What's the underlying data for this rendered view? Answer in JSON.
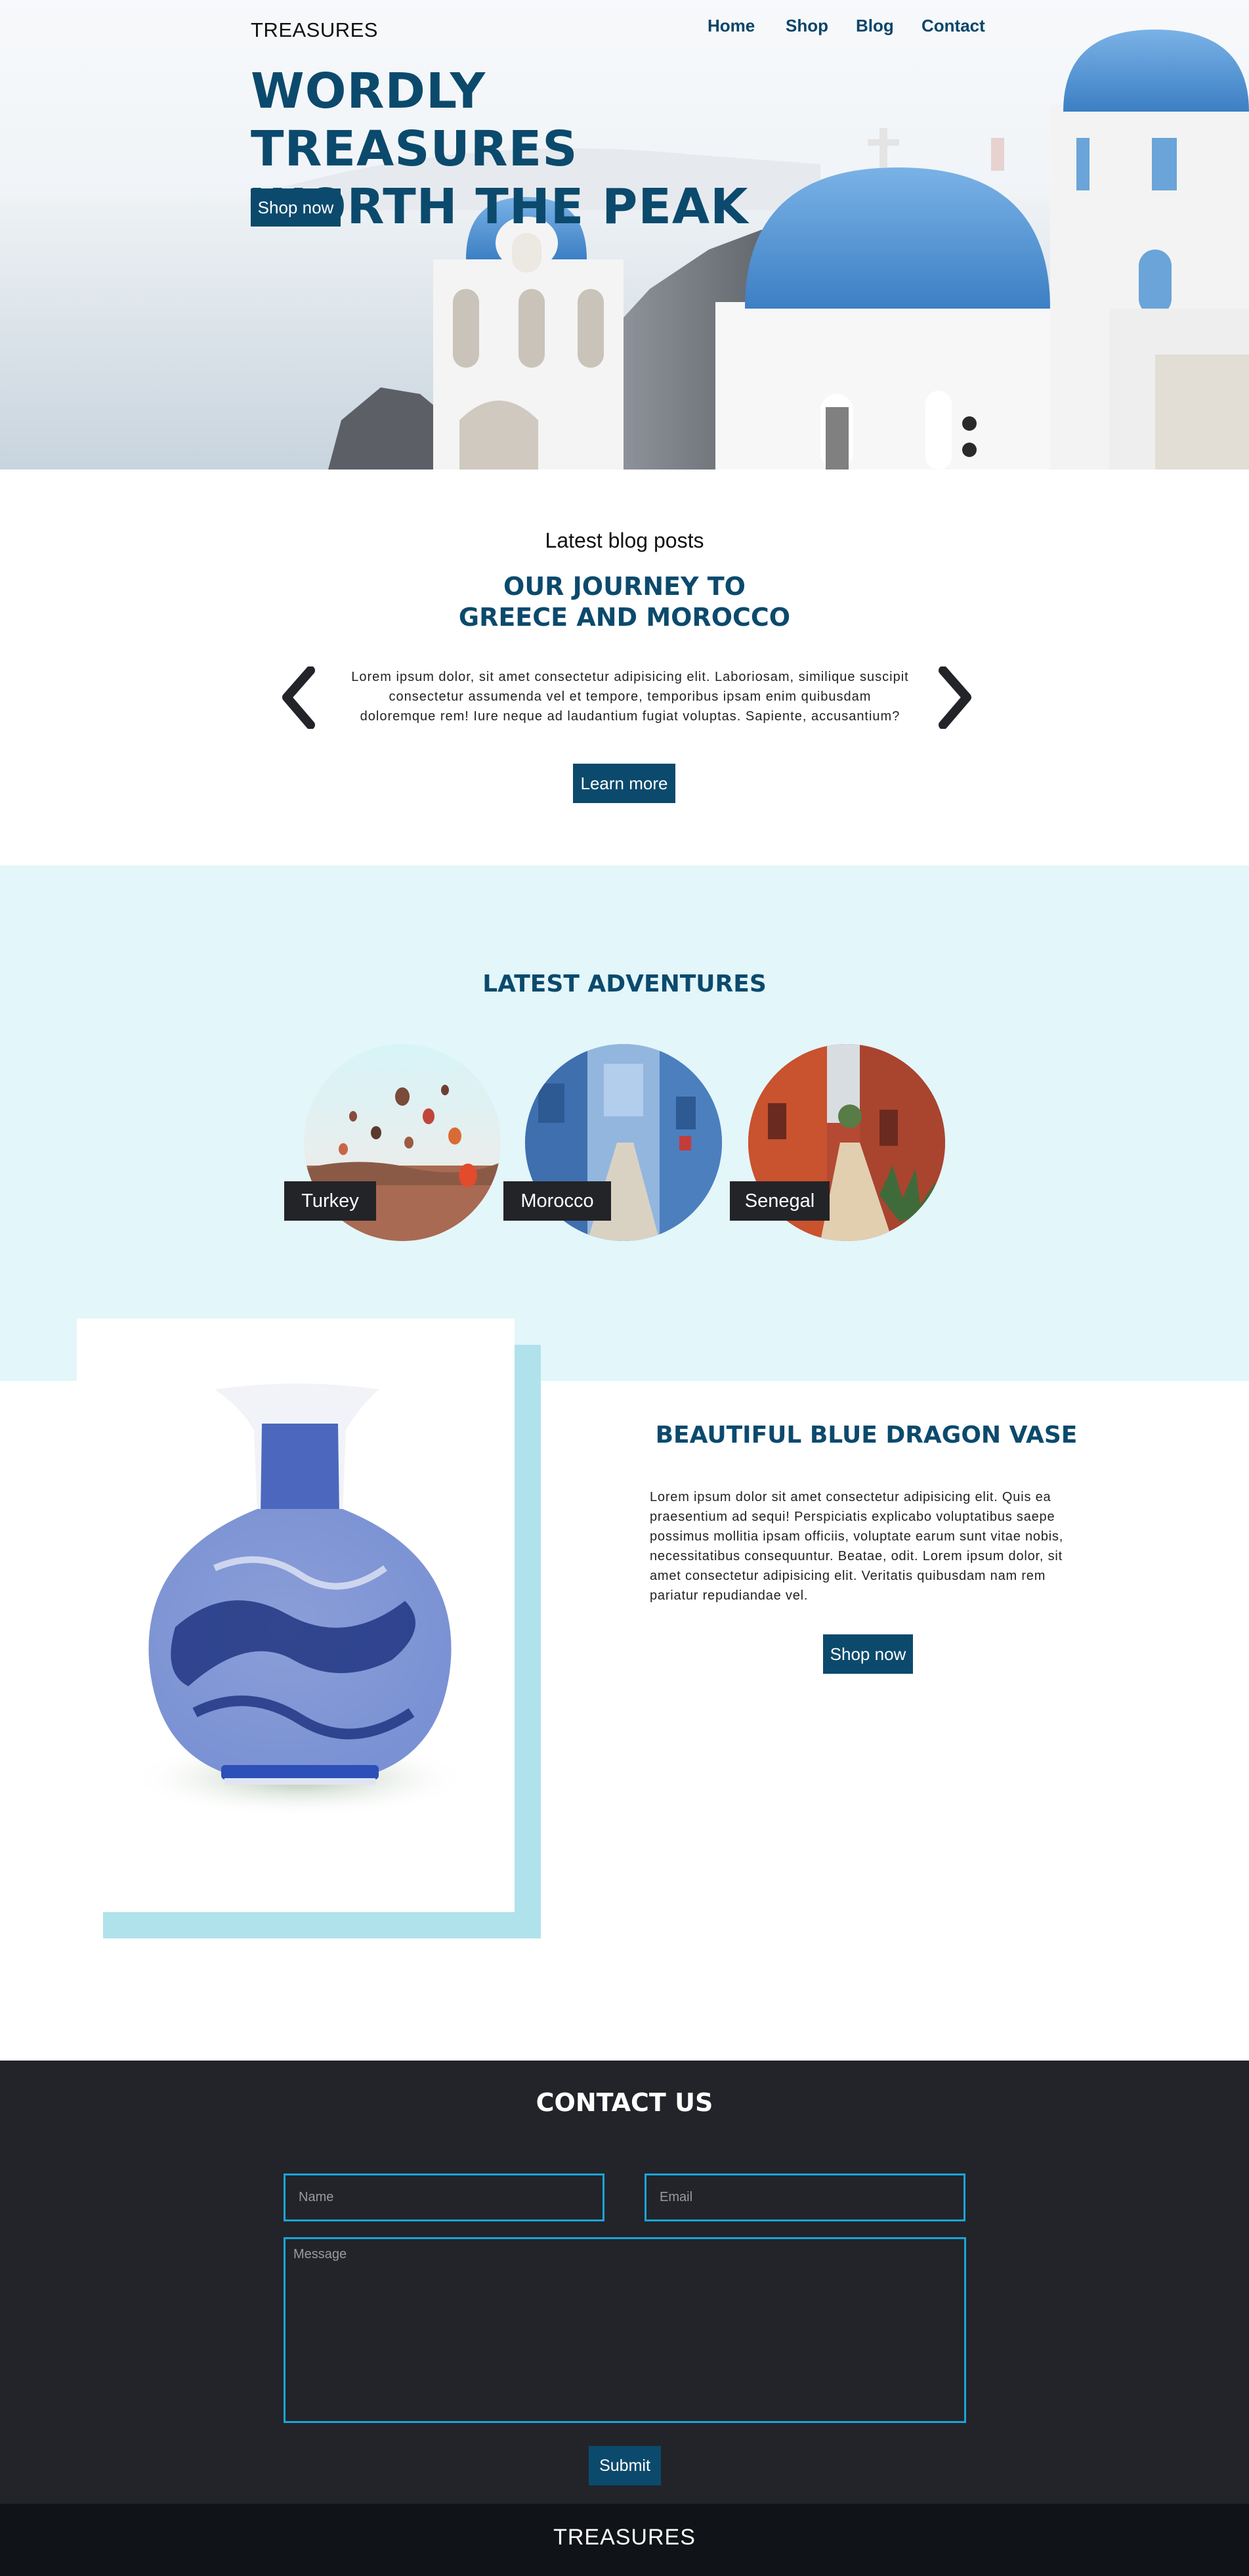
{
  "header": {
    "brand": "TREASURES",
    "nav": [
      {
        "label": "Home"
      },
      {
        "label": "Shop"
      },
      {
        "label": "Blog"
      },
      {
        "label": "Contact"
      }
    ]
  },
  "hero": {
    "title_line1": "WORDLY TREASURES",
    "title_line2": "WORTH THE PEAK",
    "button_label": "Shop now"
  },
  "blog": {
    "section_label": "Latest blog posts",
    "post_title_line1": "OUR JOURNEY TO",
    "post_title_line2": "GREECE AND MOROCCO",
    "excerpt": "Lorem ipsum dolor, sit amet consectetur adipisicing elit. Laboriosam, similique suscipit consectetur assumenda vel et tempore, temporibus ipsam enim quibusdam doloremque rem! Iure neque ad laudantium fugiat voluptas. Sapiente, accusantium?",
    "button_label": "Learn more"
  },
  "adventures": {
    "title": "LATEST ADVENTURES",
    "items": [
      {
        "label": "Turkey"
      },
      {
        "label": "Morocco"
      },
      {
        "label": "Senegal"
      }
    ]
  },
  "product": {
    "title": "BEAUTIFUL BLUE DRAGON VASE",
    "description": "Lorem ipsum dolor sit amet consectetur adipisicing elit. Quis ea praesentium ad sequi! Perspiciatis explicabo voluptatibus saepe possimus mollitia ipsam officiis, voluptate earum sunt vitae nobis, necessitatibus consequuntur. Beatae, odit. Lorem ipsum dolor, sit amet consectetur adipisicing elit. Veritatis quibusdam nam rem pariatur repudiandae vel.",
    "button_label": "Shop now"
  },
  "contact": {
    "title": "CONTACT US",
    "name_placeholder": "Name",
    "email_placeholder": "Email",
    "message_placeholder": "Message",
    "submit_label": "Submit"
  },
  "footer": {
    "brand": "TREASURES"
  },
  "colors": {
    "primary": "#0b4a6d",
    "accent_light": "#e3f6fa",
    "accent_shadow": "#b0e2ec",
    "dark": "#222429",
    "footer": "#101418",
    "field_border": "#1ba4da"
  },
  "icons": {
    "prev": "chevron-left-icon",
    "next": "chevron-right-icon"
  }
}
